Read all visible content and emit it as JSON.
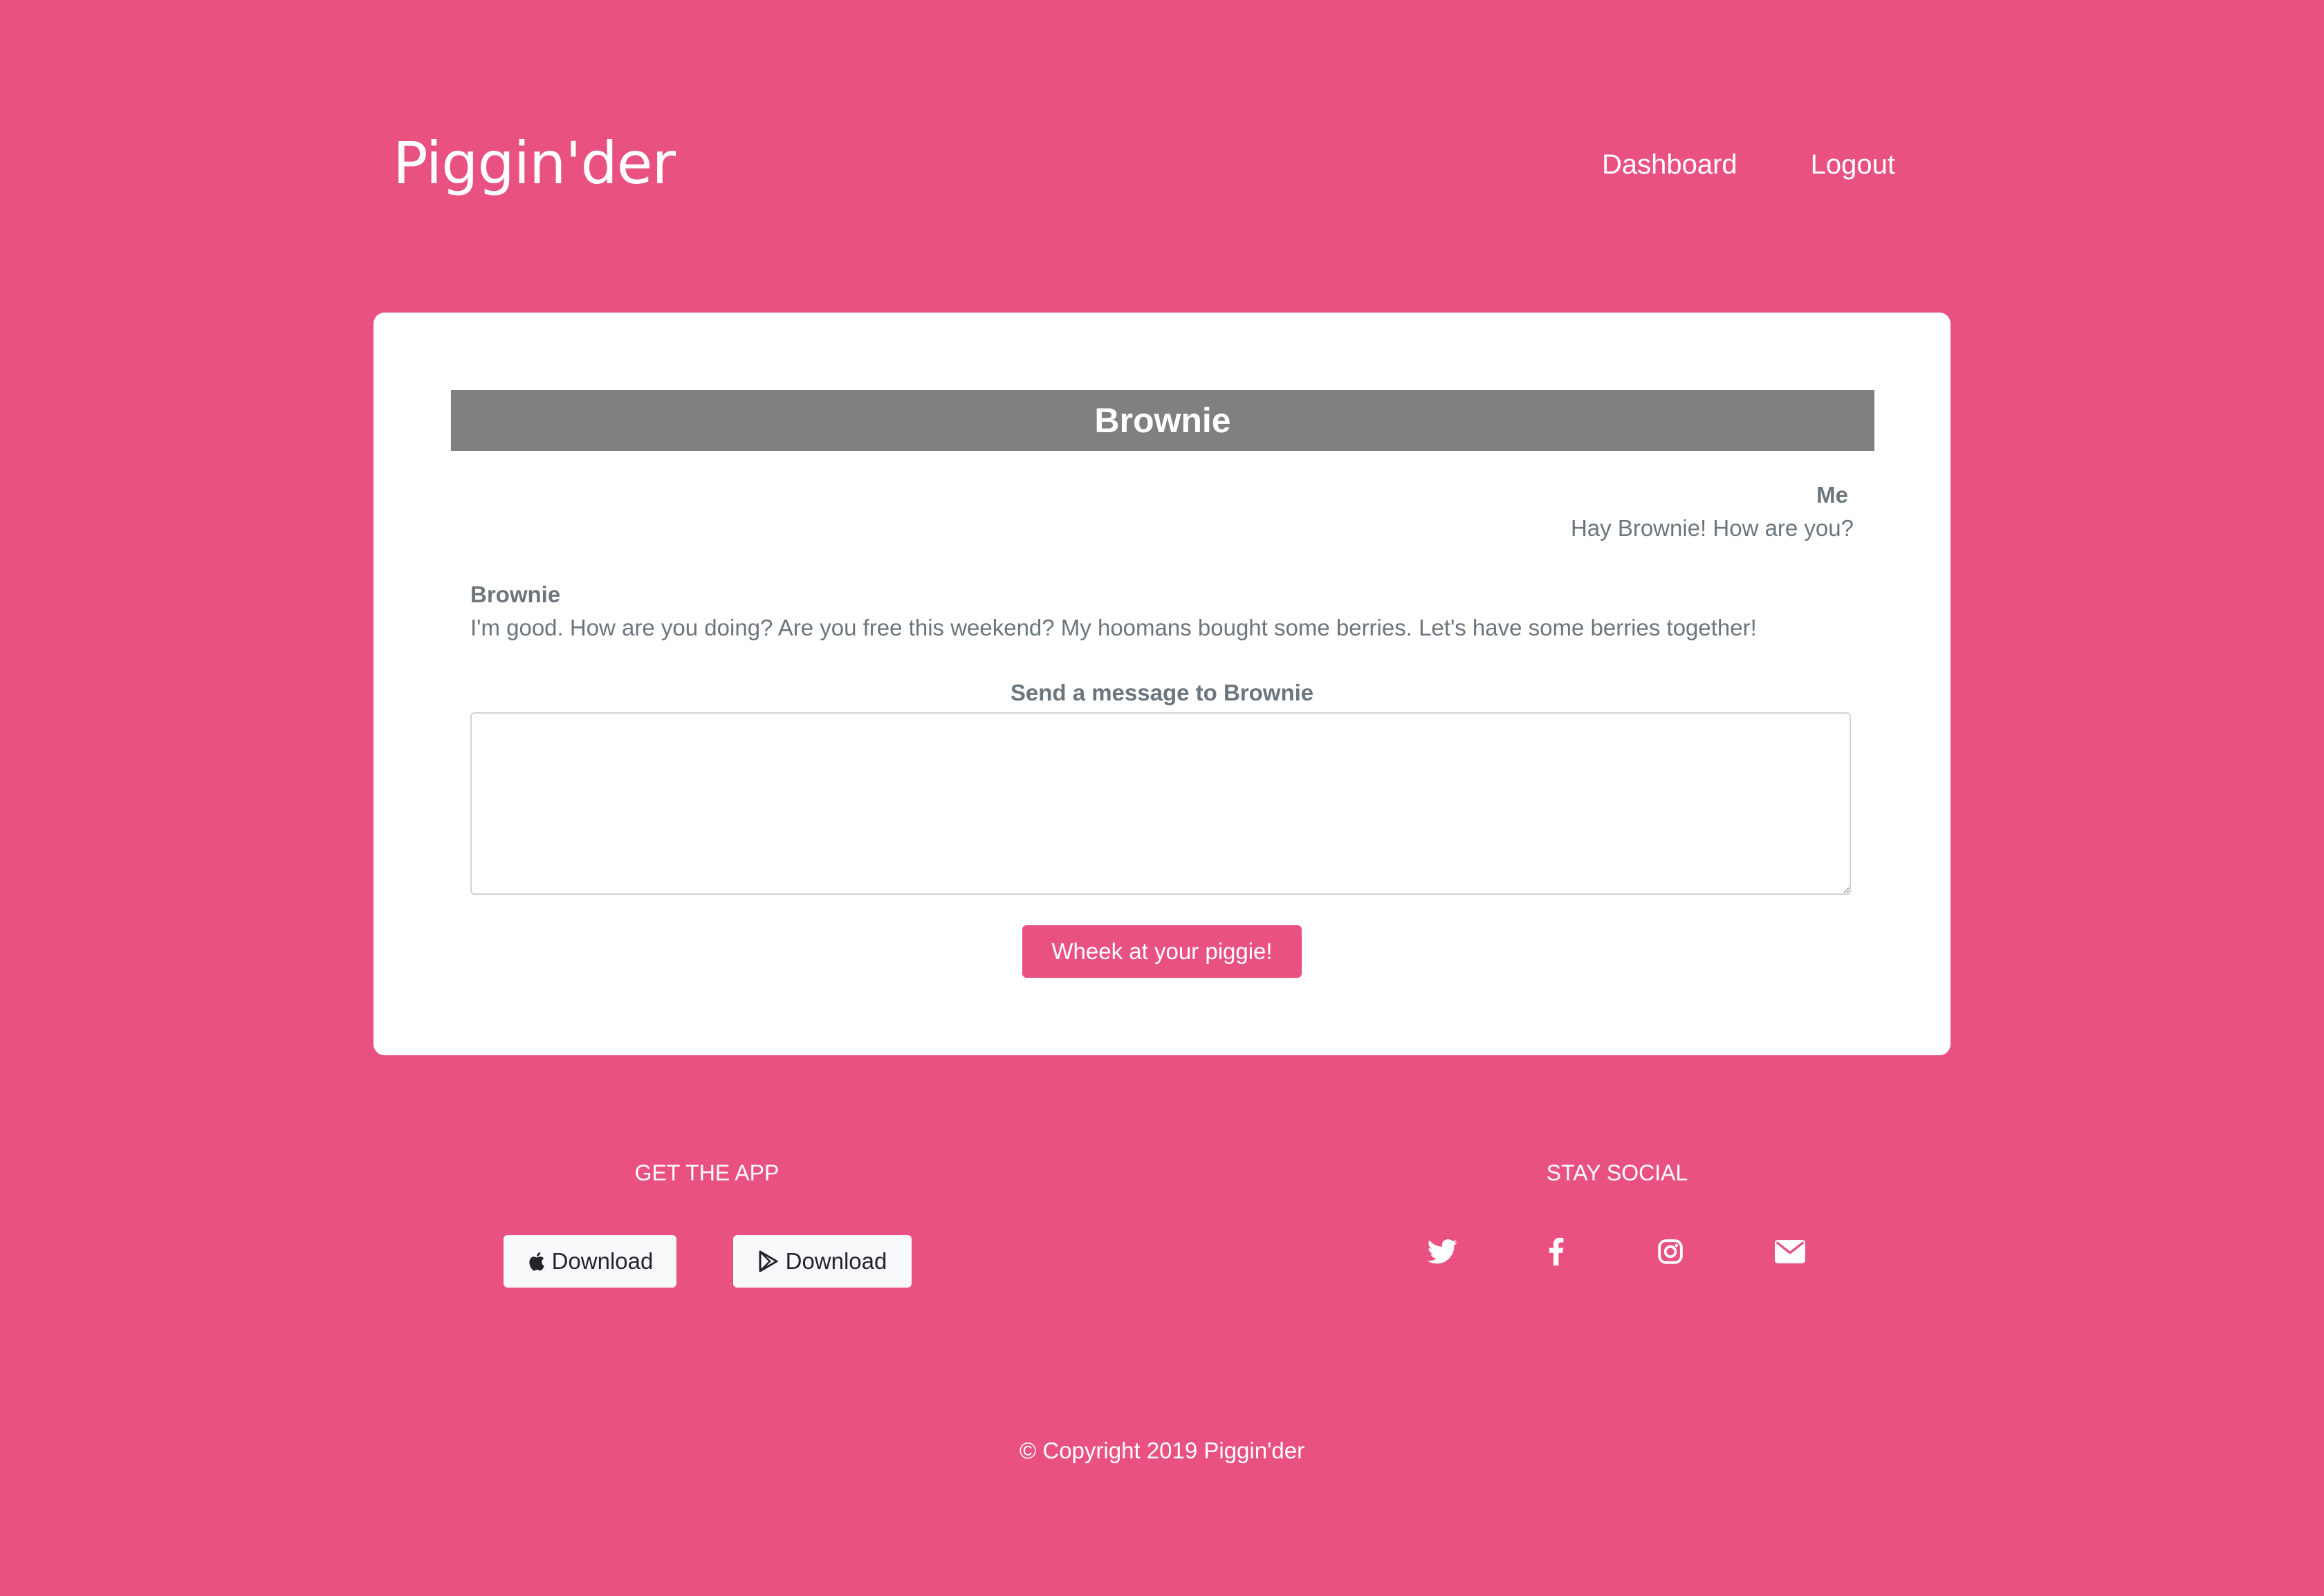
{
  "header": {
    "brand": "Piggin'der",
    "nav": {
      "dashboard": "Dashboard",
      "logout": "Logout"
    }
  },
  "chat": {
    "partner_name": "Brownie",
    "messages": [
      {
        "sender": "Me",
        "text": "Hay Brownie! How are you?"
      },
      {
        "sender": "Brownie",
        "text": "I'm good. How are you doing? Are you free this weekend? My hoomans bought some berries. Let's have some berries together!"
      }
    ],
    "send_label": "Send a message to Brownie",
    "message_value": "",
    "send_button": "Wheek at your piggie!"
  },
  "footer": {
    "get_app": {
      "heading": "GET THE APP",
      "buttons": [
        {
          "icon": "apple-icon",
          "label": "Download"
        },
        {
          "icon": "google-play-icon",
          "label": "Download"
        }
      ]
    },
    "social": {
      "heading": "STAY SOCIAL",
      "icons": [
        "twitter-icon",
        "facebook-icon",
        "instagram-icon",
        "mail-icon"
      ]
    },
    "copyright": "© Copyright 2019 Piggin'der"
  },
  "colors": {
    "background": "#e95280",
    "card": "#ffffff",
    "chat_header": "#808080",
    "text_muted": "#6c757d",
    "button": "#e95280"
  }
}
